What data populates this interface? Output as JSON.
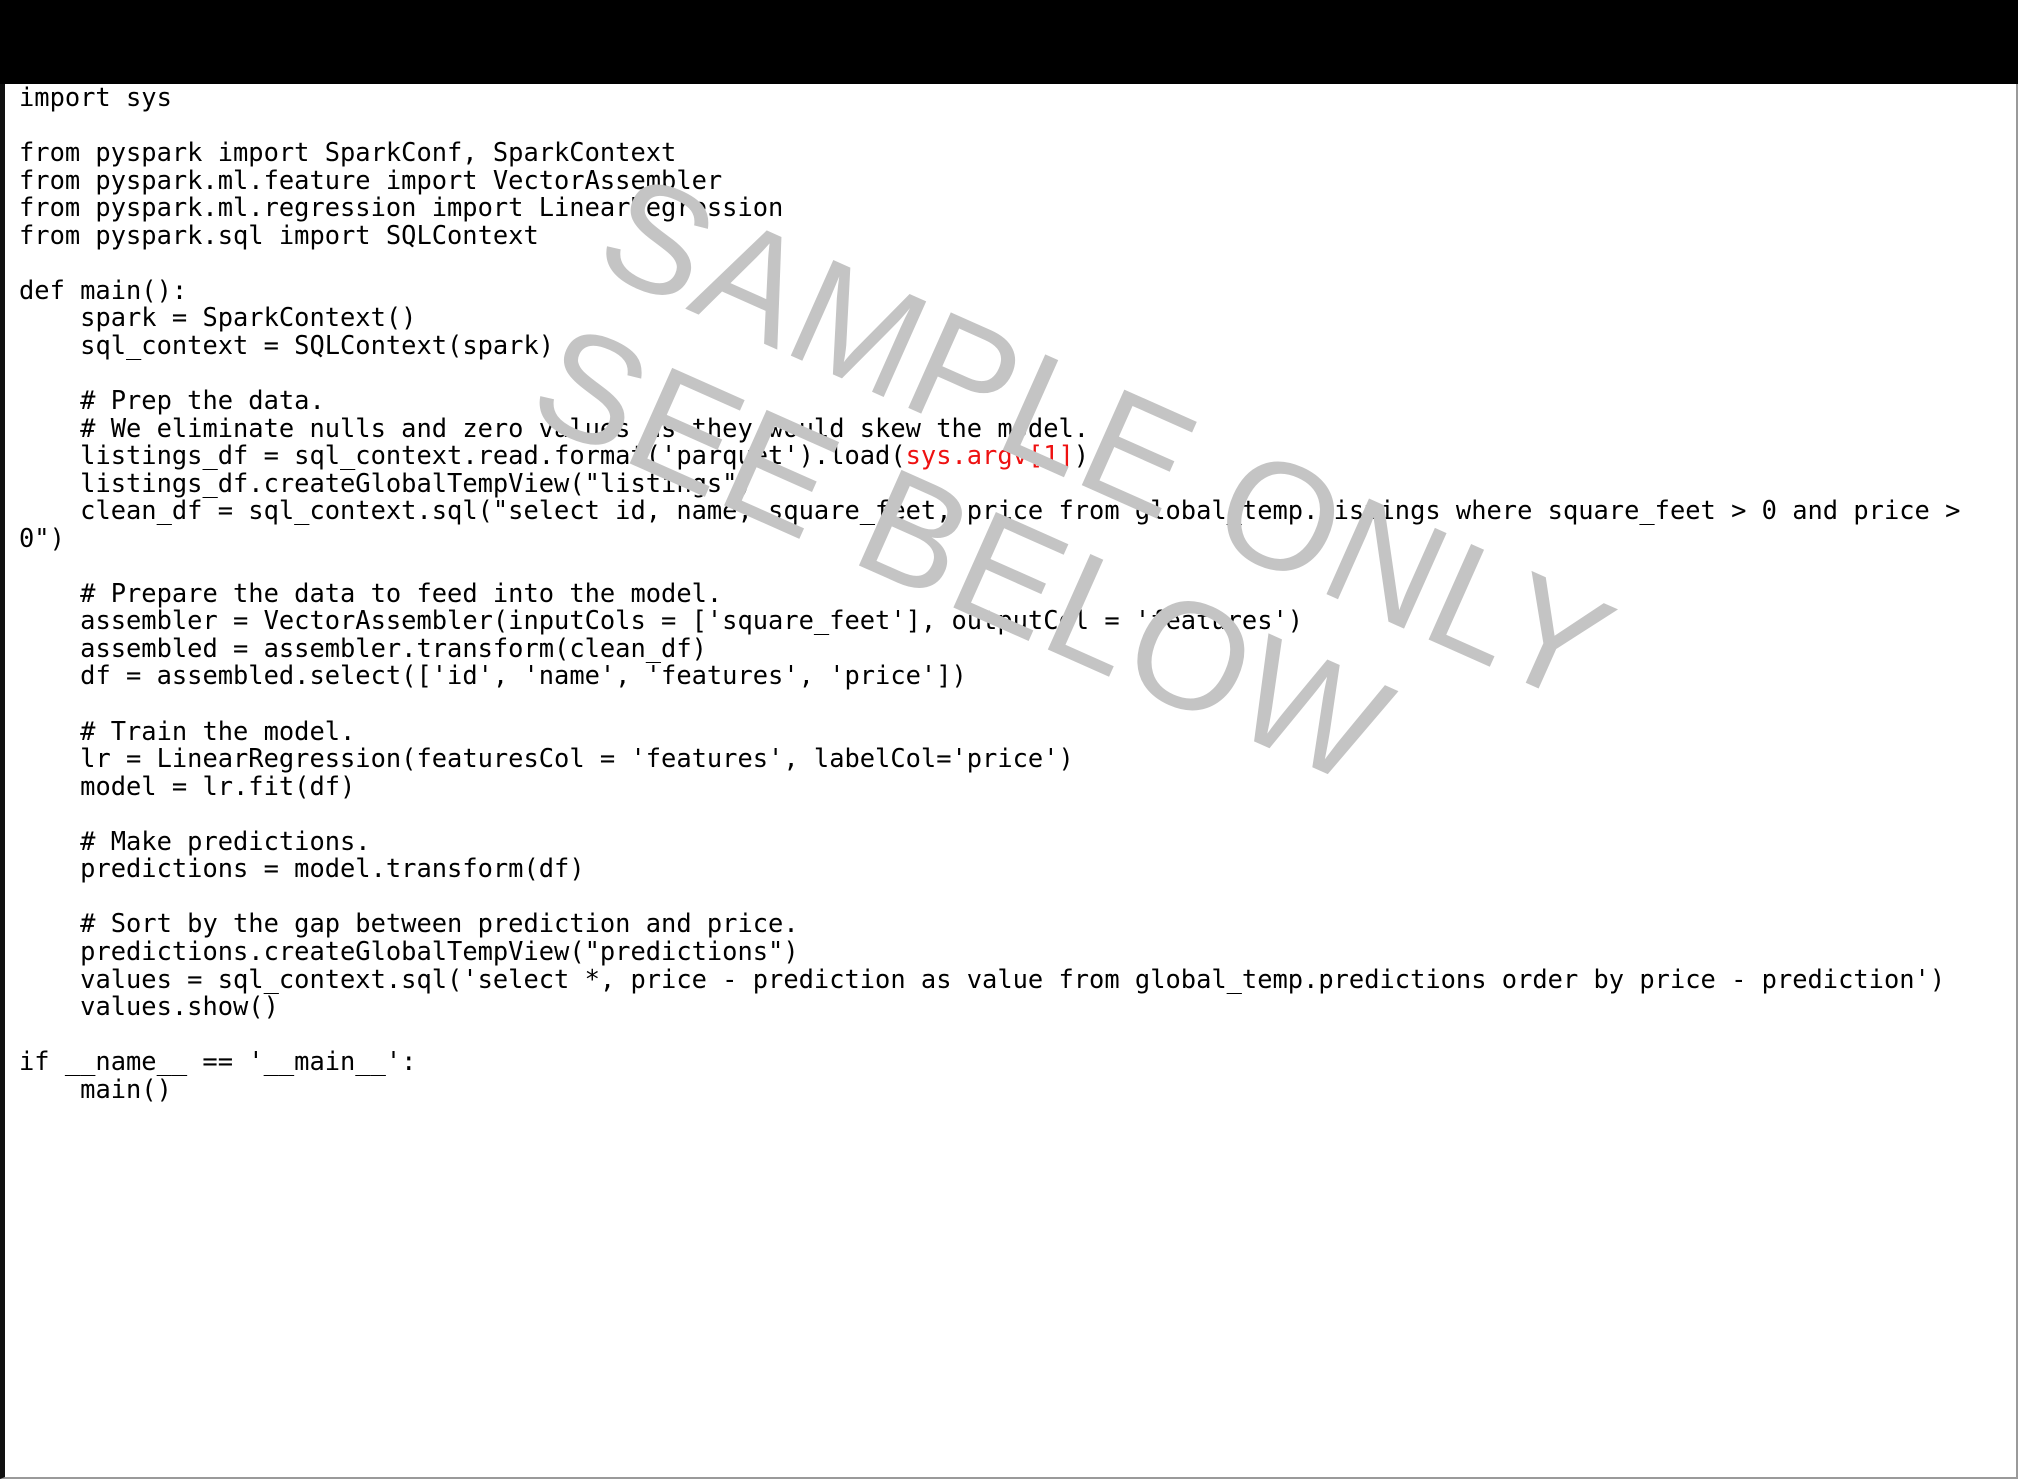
{
  "document": {
    "kind": "code-listing",
    "language": "python",
    "background_color": "#ffffff",
    "text_color": "#000000",
    "accent_color": "#ee1111",
    "top_band_color": "#000000",
    "border_color": "#9a9a9a"
  },
  "watermark": {
    "color": "#c4c4c4",
    "rotation_degrees": 24,
    "line1": "SAMPLE ONLY",
    "line2": "SEE BELOW"
  },
  "code": {
    "highlight_token": "sys.argv[1]",
    "part_before_highlight": "import sys\n\nfrom pyspark import SparkConf, SparkContext\nfrom pyspark.ml.feature import VectorAssembler\nfrom pyspark.ml.regression import LinearRegression\nfrom pyspark.sql import SQLContext\n\ndef main():\n    spark = SparkContext()\n    sql_context = SQLContext(spark)\n\n    # Prep the data.\n    # We eliminate nulls and zero values as they would skew the model.\n    listings_df = sql_context.read.format('parquet').load(",
    "part_after_highlight": ")\n    listings_df.createGlobalTempView(\"listings\")\n    clean_df = sql_context.sql(\"select id, name, square_feet, price from global_temp.listings where square_feet > 0 and price > 0\")\n\n    # Prepare the data to feed into the model.\n    assembler = VectorAssembler(inputCols = ['square_feet'], outputCol = 'features')\n    assembled = assembler.transform(clean_df)\n    df = assembled.select(['id', 'name', 'features', 'price'])\n\n    # Train the model.\n    lr = LinearRegression(featuresCol = 'features', labelCol='price')\n    model = lr.fit(df)\n\n    # Make predictions.\n    predictions = model.transform(df)\n\n    # Sort by the gap between prediction and price.\n    predictions.createGlobalTempView(\"predictions\")\n    values = sql_context.sql('select *, price - prediction as value from global_temp.predictions order by price - prediction')\n    values.show()\n\nif __name__ == '__main__':\n    main()",
    "lines": [
      "import sys",
      "",
      "from pyspark import SparkConf, SparkContext",
      "from pyspark.ml.feature import VectorAssembler",
      "from pyspark.ml.regression import LinearRegression",
      "from pyspark.sql import SQLContext",
      "",
      "def main():",
      "    spark = SparkContext()",
      "    sql_context = SQLContext(spark)",
      "",
      "    # Prep the data.",
      "    # We eliminate nulls and zero values as they would skew the model.",
      "    listings_df = sql_context.read.format('parquet').load(sys.argv[1])",
      "    listings_df.createGlobalTempView(\"listings\")",
      "    clean_df = sql_context.sql(\"select id, name, square_feet, price from global_temp.listings where square_feet > 0 and price > 0\")",
      "",
      "    # Prepare the data to feed into the model.",
      "    assembler = VectorAssembler(inputCols = ['square_feet'], outputCol = 'features')",
      "    assembled = assembler.transform(clean_df)",
      "    df = assembled.select(['id', 'name', 'features', 'price'])",
      "",
      "    # Train the model.",
      "    lr = LinearRegression(featuresCol = 'features', labelCol='price')",
      "    model = lr.fit(df)",
      "",
      "    # Make predictions.",
      "    predictions = model.transform(df)",
      "",
      "    # Sort by the gap between prediction and price.",
      "    predictions.createGlobalTempView(\"predictions\")",
      "    values = sql_context.sql('select *, price - prediction as value from global_temp.predictions order by price - prediction')",
      "    values.show()",
      "",
      "if __name__ == '__main__':",
      "    main()"
    ]
  }
}
